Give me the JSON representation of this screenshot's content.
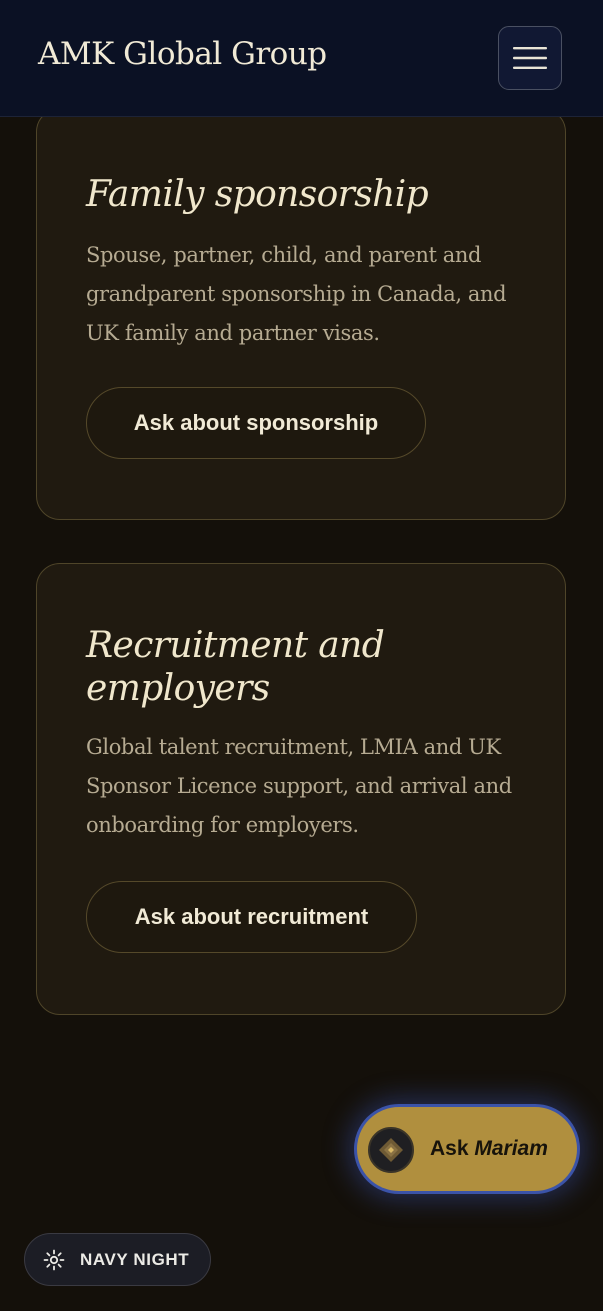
{
  "header": {
    "brand": "AMK Global Group",
    "menu_icon": "hamburger-menu-icon"
  },
  "cards": [
    {
      "title": "Family sponsorship",
      "description": "Spouse, partner, child, and parent and grandparent sponsorship in Canada, and UK family and partner visas.",
      "button_label": "Ask about sponsorship"
    },
    {
      "title": "Recruitment and employers",
      "description": "Global talent recruitment, LMIA and UK Sponsor Licence support, and arrival and onboarding for employers.",
      "button_label": "Ask about recruitment"
    }
  ],
  "assistant": {
    "label_prefix": "Ask",
    "name": "Mariam",
    "icon": "diamond-icon"
  },
  "theme_toggle": {
    "label": "NAVY NIGHT",
    "icon": "sun-icon"
  },
  "colors": {
    "header_bg": "#0b1124",
    "page_bg": "#14100a",
    "card_bg": "#201a10",
    "card_border": "#4f4529",
    "accent_gold": "#b08f3e",
    "accent_blue": "#3b53a8",
    "title_text": "#f0e7cc",
    "body_text": "#b6ab92"
  }
}
